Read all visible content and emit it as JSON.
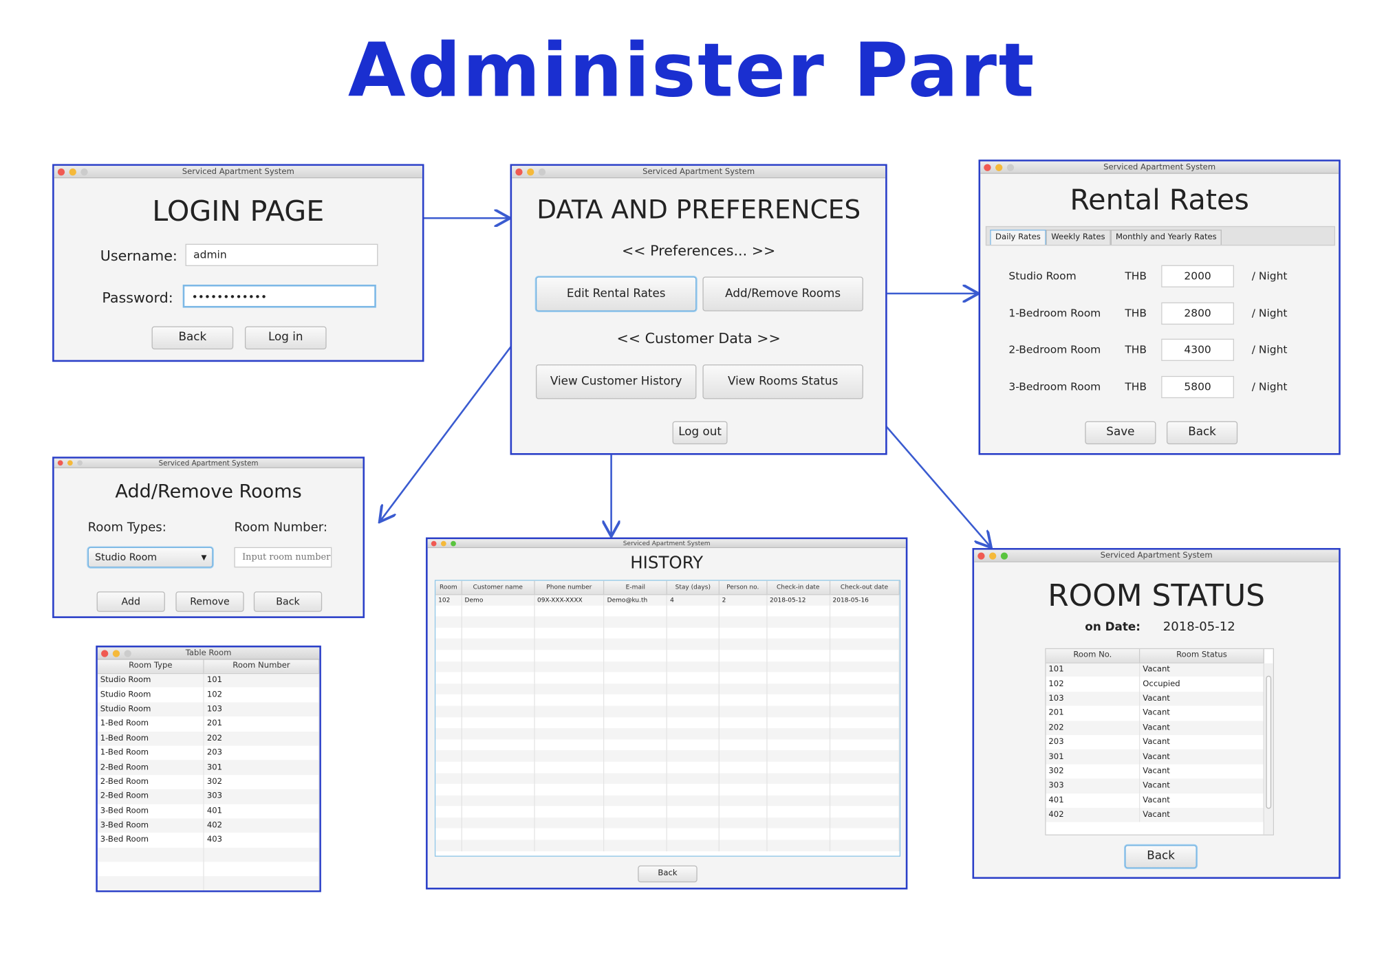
{
  "title": "Administer Part",
  "window_title": "Serviced Apartment System",
  "colors": {
    "accent": "#1a2fd0",
    "frame": "#2a3fc8",
    "arrow": "#3a5bd0"
  },
  "login": {
    "heading": "LOGIN PAGE",
    "username_label": "Username:",
    "username_value": "admin",
    "password_label": "Password:",
    "password_value": "••••••••••••",
    "back": "Back",
    "login": "Log in"
  },
  "data": {
    "heading": "DATA AND PREFERENCES",
    "preferences": "<< Preferences... >>",
    "edit_rates": "Edit Rental Rates",
    "add_remove": "Add/Remove Rooms",
    "customer_data": "<< Customer Data >>",
    "view_history": "View Customer History",
    "view_status": "View Rooms Status",
    "logout": "Log out"
  },
  "rental": {
    "heading": "Rental Rates",
    "tabs": [
      "Daily Rates",
      "Weekly Rates",
      "Monthly and Yearly Rates"
    ],
    "currency": "THB",
    "unit": "/ Night",
    "rows": [
      {
        "room": "Studio Room",
        "rate": "2000"
      },
      {
        "room": "1-Bedroom Room",
        "rate": "2800"
      },
      {
        "room": "2-Bedroom Room",
        "rate": "4300"
      },
      {
        "room": "3-Bedroom Room",
        "rate": "5800"
      }
    ],
    "save": "Save",
    "back": "Back"
  },
  "addremove": {
    "heading": "Add/Remove Rooms",
    "types_label": "Room Types:",
    "number_label": "Room Number:",
    "type_value": "Studio Room",
    "number_placeholder": "Input room number",
    "add": "Add",
    "remove": "Remove",
    "back": "Back"
  },
  "tableroom": {
    "window_title": "Table Room",
    "columns": [
      "Room Type",
      "Room Number"
    ],
    "rows": [
      [
        "Studio Room",
        "101"
      ],
      [
        "Studio Room",
        "102"
      ],
      [
        "Studio Room",
        "103"
      ],
      [
        "1-Bed Room",
        "201"
      ],
      [
        "1-Bed Room",
        "202"
      ],
      [
        "1-Bed Room",
        "203"
      ],
      [
        "2-Bed Room",
        "301"
      ],
      [
        "2-Bed Room",
        "302"
      ],
      [
        "2-Bed Room",
        "303"
      ],
      [
        "3-Bed Room",
        "401"
      ],
      [
        "3-Bed Room",
        "402"
      ],
      [
        "3-Bed Room",
        "403"
      ]
    ]
  },
  "history": {
    "heading": "HISTORY",
    "columns": [
      "Room",
      "Customer name",
      "Phone number",
      "E-mail",
      "Stay (days)",
      "Person no.",
      "Check-in date",
      "Check-out date"
    ],
    "rows": [
      [
        "102",
        "Demo",
        "09X-XXX-XXXX",
        "Demo@ku.th",
        "4",
        "2",
        "2018-05-12",
        "2018-05-16"
      ]
    ],
    "back": "Back"
  },
  "status": {
    "heading": "ROOM STATUS",
    "date_label": "on Date:",
    "date_value": "2018-05-12",
    "columns": [
      "Room No.",
      "Room Status"
    ],
    "rows": [
      [
        "101",
        "Vacant"
      ],
      [
        "102",
        "Occupied"
      ],
      [
        "103",
        "Vacant"
      ],
      [
        "201",
        "Vacant"
      ],
      [
        "202",
        "Vacant"
      ],
      [
        "203",
        "Vacant"
      ],
      [
        "301",
        "Vacant"
      ],
      [
        "302",
        "Vacant"
      ],
      [
        "303",
        "Vacant"
      ],
      [
        "401",
        "Vacant"
      ],
      [
        "402",
        "Vacant"
      ]
    ],
    "back": "Back"
  }
}
